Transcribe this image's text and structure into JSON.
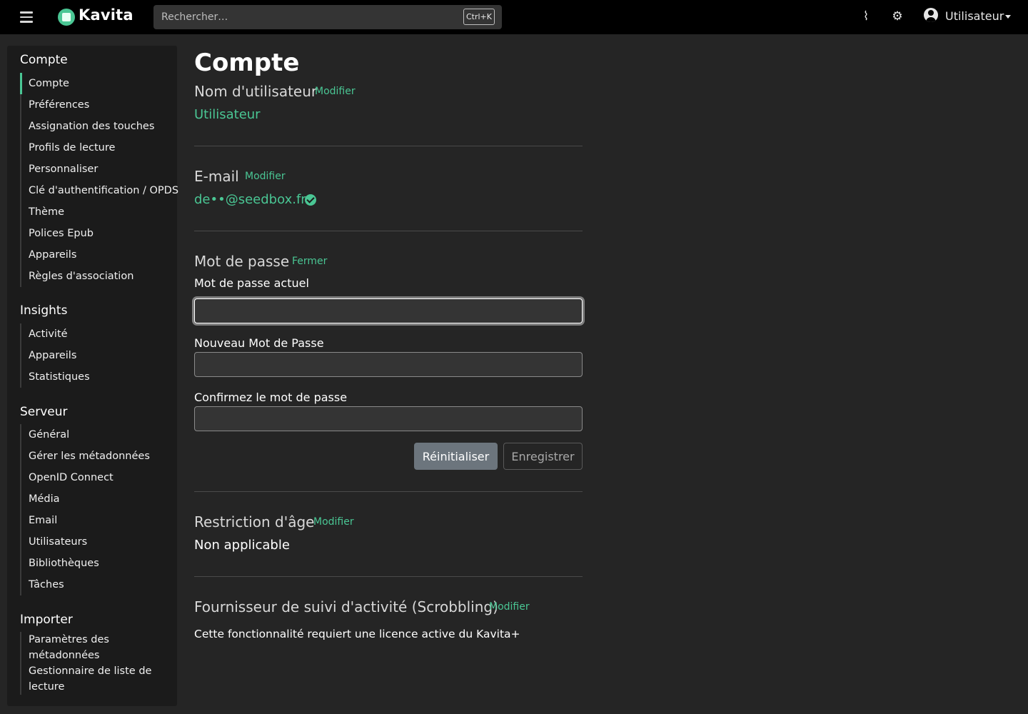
{
  "navbar": {
    "brand": "Kavita",
    "search_placeholder": "Rechercher…",
    "search_shortcut": "Ctrl+K",
    "user_label": "Utilisateur"
  },
  "sidebar": {
    "account": {
      "title": "Compte",
      "items": [
        "Compte",
        "Préférences",
        "Assignation des touches",
        "Profils de lecture",
        "Personnaliser",
        "Clé d'authentification / OPDS",
        "Thème",
        "Polices Epub",
        "Appareils",
        "Règles d'association"
      ]
    },
    "insights": {
      "title": "Insights",
      "items": [
        "Activité",
        "Appareils",
        "Statistiques"
      ]
    },
    "server": {
      "title": "Serveur",
      "items": [
        "Général",
        "Gérer les métadonnées",
        "OpenID Connect",
        "Média",
        "Email",
        "Utilisateurs",
        "Bibliothèques",
        "Tâches"
      ]
    },
    "import": {
      "title": "Importer",
      "items": [
        "Paramètres des métadonnées",
        "Gestionnaire de liste de lecture"
      ]
    }
  },
  "main": {
    "title": "Compte",
    "username": {
      "label": "Nom d'utilisateur",
      "action": "Modifier",
      "value": "Utilisateur"
    },
    "email": {
      "label": "E-mail",
      "action": "Modifier",
      "value": "de••@seedbox.fr"
    },
    "password": {
      "label": "Mot de passe",
      "action": "Fermer",
      "current_label": "Mot de passe actuel",
      "new_label": "Nouveau Mot de Passe",
      "confirm_label": "Confirmez le mot de passe",
      "reset_button": "Réinitialiser",
      "save_button": "Enregistrer"
    },
    "age_restriction": {
      "label": "Restriction d'âge",
      "action": "Modifier",
      "value": "Non applicable"
    },
    "scrobbling": {
      "label": "Fournisseur de suivi d'activité (Scrobbling)",
      "action": "Modifier",
      "note": "Cette fonctionnalité requiert une licence active du Kavita+"
    }
  }
}
